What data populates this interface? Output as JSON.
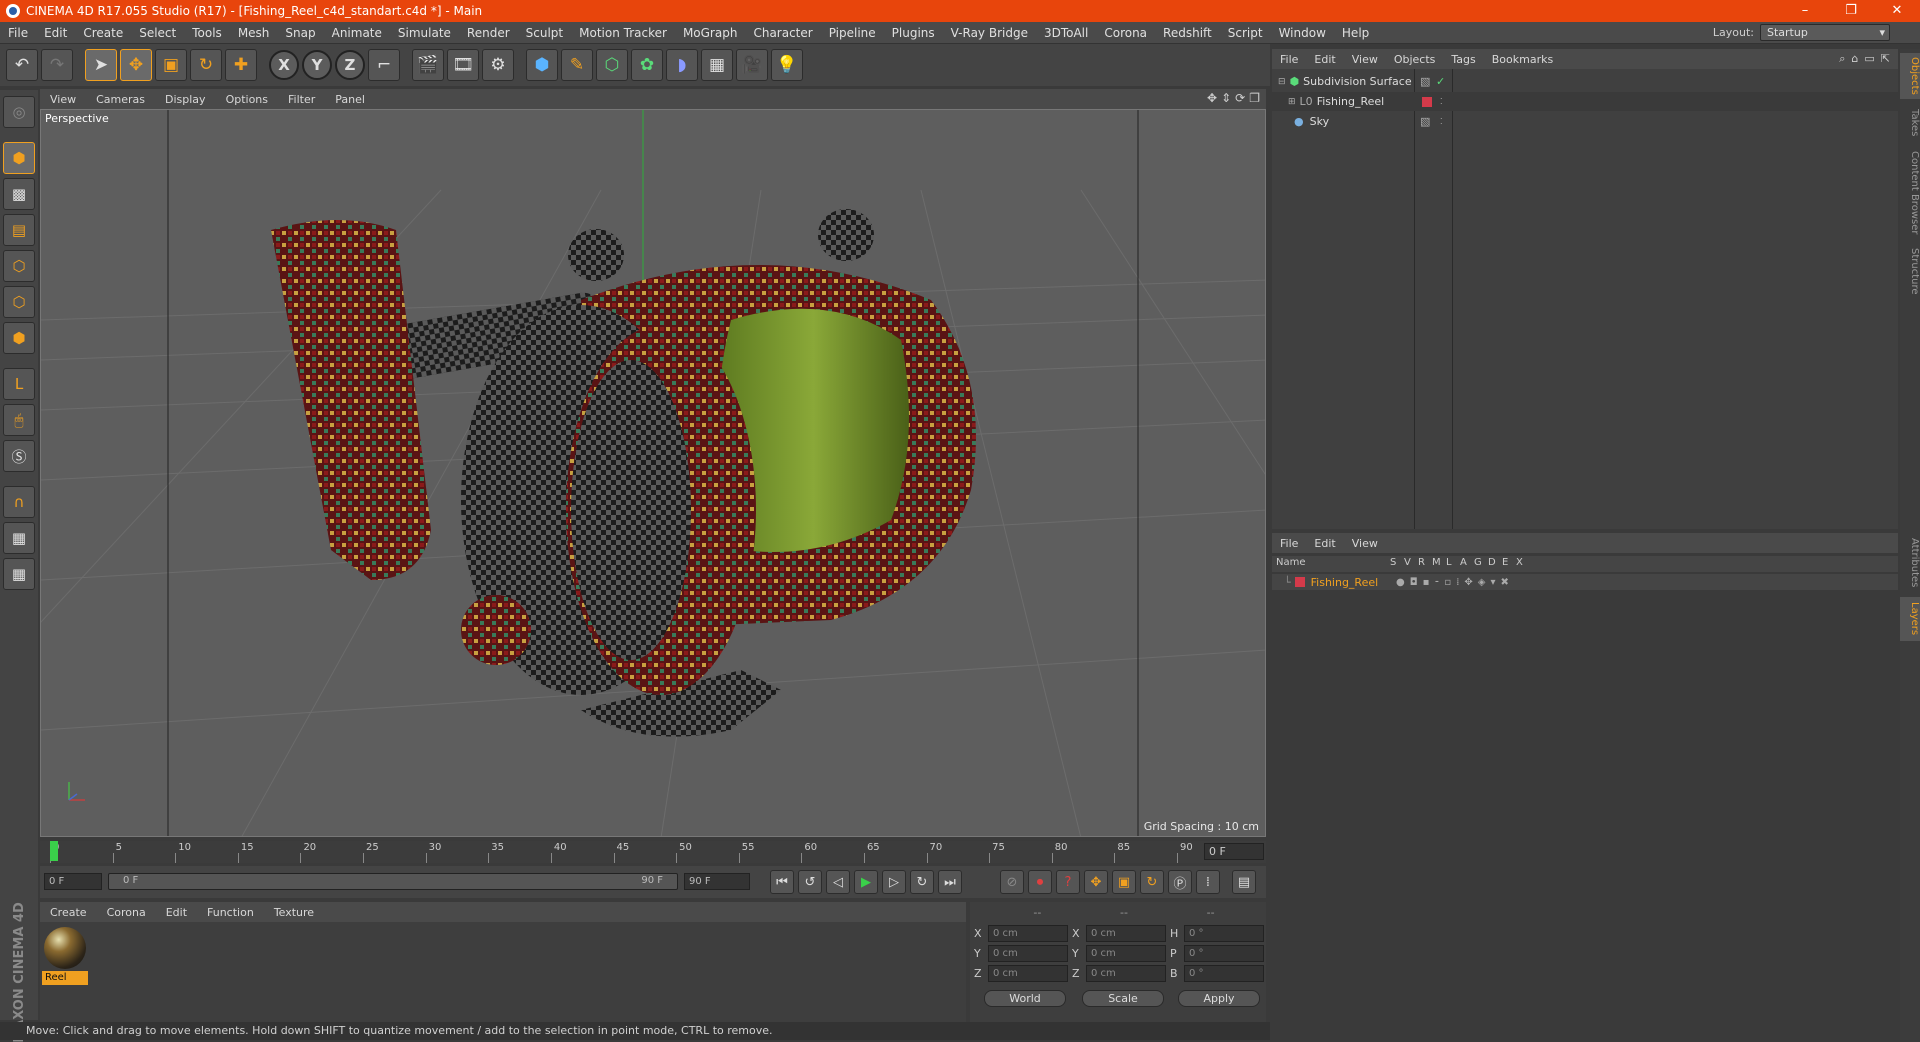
{
  "window": {
    "title": "CINEMA 4D R17.055 Studio (R17) - [Fishing_Reel_c4d_standart.c4d *] - Main",
    "minimize": "–",
    "restore": "❐",
    "close": "✕"
  },
  "menu": [
    "File",
    "Edit",
    "Create",
    "Select",
    "Tools",
    "Mesh",
    "Snap",
    "Animate",
    "Simulate",
    "Render",
    "Sculpt",
    "Motion Tracker",
    "MoGraph",
    "Character",
    "Pipeline",
    "Plugins",
    "V-Ray Bridge",
    "3DToAll",
    "Corona",
    "Redshift",
    "Script",
    "Window",
    "Help"
  ],
  "layout": {
    "label": "Layout:",
    "value": "Startup"
  },
  "viewport": {
    "menu": [
      "View",
      "Cameras",
      "Display",
      "Options",
      "Filter",
      "Panel"
    ],
    "label": "Perspective",
    "grid_spacing": "Grid Spacing : 10 cm"
  },
  "timeline": {
    "ticks": [
      "0",
      "5",
      "10",
      "15",
      "20",
      "25",
      "30",
      "35",
      "40",
      "45",
      "50",
      "55",
      "60",
      "65",
      "70",
      "75",
      "80",
      "85",
      "90"
    ],
    "current_frame": "0 F",
    "start": "0 F",
    "range_start": "0 F",
    "range_end": "90 F",
    "end": "90 F"
  },
  "material_manager": {
    "menu": [
      "Create",
      "Corona",
      "Edit",
      "Function",
      "Texture"
    ],
    "material_name": "Reel"
  },
  "brand": "MAXON CINEMA 4D",
  "coordinates": {
    "headers": [
      "--",
      "--",
      "--"
    ],
    "rows": [
      {
        "a": "X",
        "av": "0 cm",
        "b": "X",
        "bv": "0 cm",
        "c": "H",
        "cv": "0 °"
      },
      {
        "a": "Y",
        "av": "0 cm",
        "b": "Y",
        "bv": "0 cm",
        "c": "P",
        "cv": "0 °"
      },
      {
        "a": "Z",
        "av": "0 cm",
        "b": "Z",
        "bv": "0 cm",
        "c": "B",
        "cv": "0 °"
      }
    ],
    "world": "World",
    "scale": "Scale",
    "apply": "Apply"
  },
  "status": "Move: Click and drag to move elements. Hold down SHIFT to quantize movement / add to the selection in point mode, CTRL to remove.",
  "object_manager": {
    "menu": [
      "File",
      "Edit",
      "View",
      "Objects",
      "Tags",
      "Bookmarks"
    ],
    "objects": [
      {
        "name": "Subdivision Surface",
        "check": "✓"
      },
      {
        "name": "Fishing_Reel",
        "check": ""
      },
      {
        "name": "Sky",
        "check": ""
      }
    ]
  },
  "layer_manager": {
    "menu": [
      "File",
      "Edit",
      "View"
    ],
    "columns": [
      "Name",
      "S",
      "V",
      "R",
      "M",
      "L",
      "A",
      "G",
      "D",
      "E",
      "X"
    ],
    "layers": [
      {
        "name": "Fishing_Reel"
      }
    ]
  },
  "right_tabs": [
    "Objects",
    "Takes",
    "Content Browser",
    "Structure",
    "Attributes",
    "Layers"
  ],
  "colors": {
    "accent": "#f0a020",
    "titlebar": "#e8450c",
    "layer_color": "#d43a4a"
  }
}
